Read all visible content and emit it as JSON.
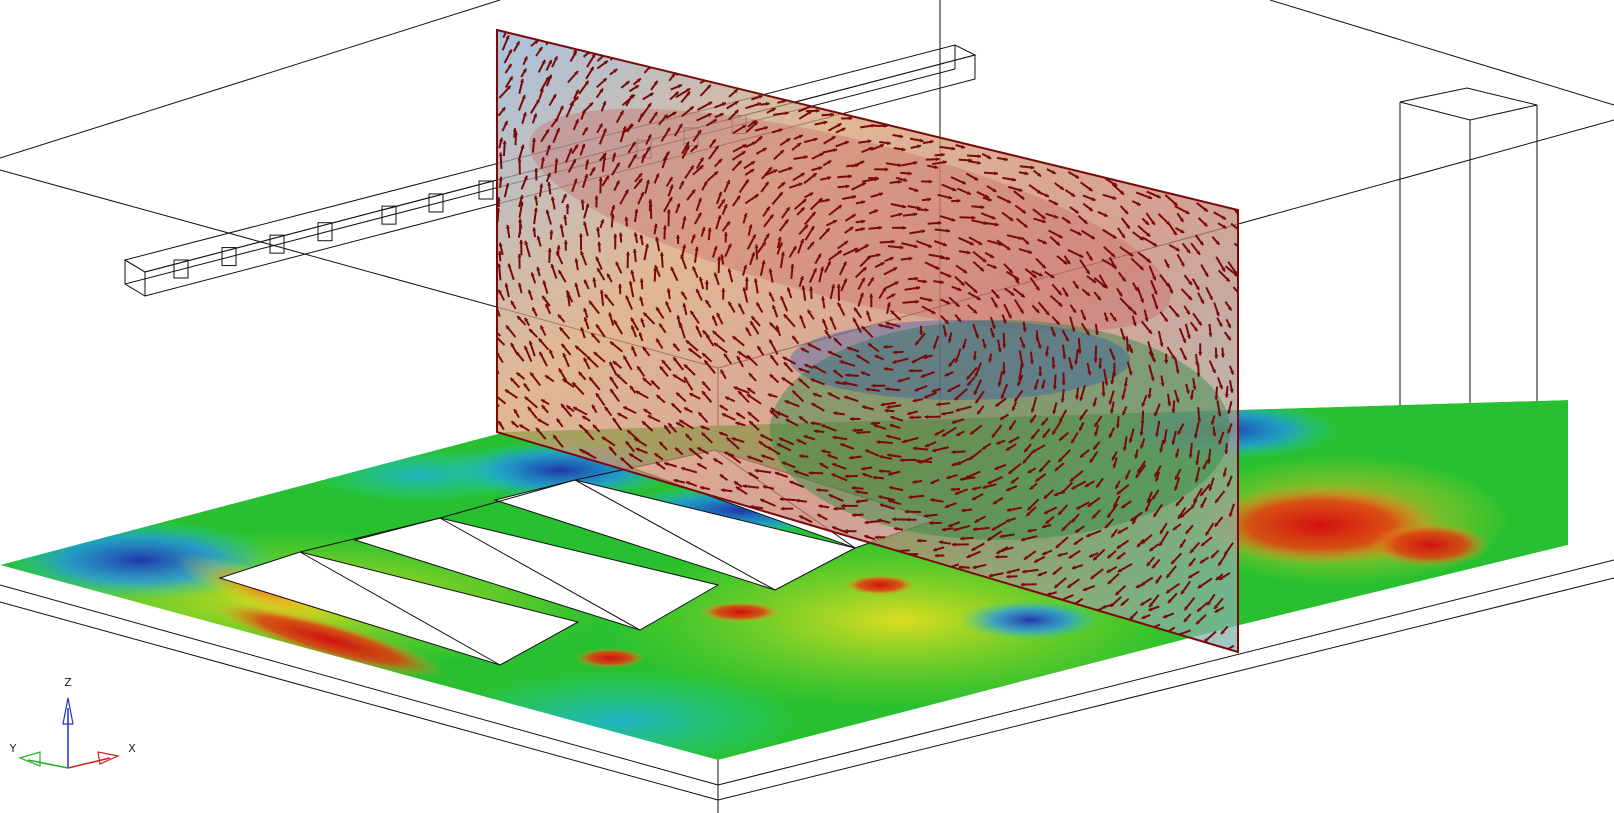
{
  "axes": {
    "x_label": "X",
    "y_label": "Y",
    "z_label": "Z"
  },
  "colors": {
    "background": "#ffffff",
    "wireframe": "#111111",
    "vector": "#7a0a0a",
    "axis_x": "#d62020",
    "axis_y": "#20b020",
    "axis_z": "#2030d0",
    "contour_scale": [
      "#1f2fb0",
      "#1e90ff",
      "#1fd0c0",
      "#22c030",
      "#9ad820",
      "#f0e020",
      "#f08020",
      "#d01010"
    ]
  }
}
